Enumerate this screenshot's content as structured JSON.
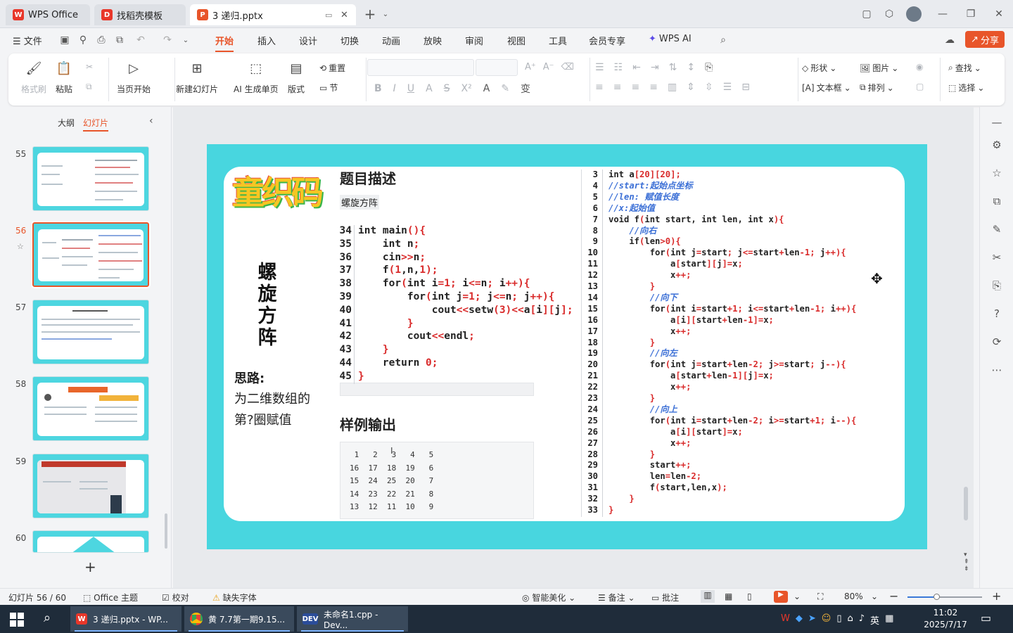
{
  "tabs": [
    {
      "label": "WPS Office"
    },
    {
      "label": "找稻壳模板"
    },
    {
      "label": "3  递归.pptx"
    }
  ],
  "menu": {
    "file": "文件",
    "items": [
      "开始",
      "插入",
      "设计",
      "切换",
      "动画",
      "放映",
      "审阅",
      "视图",
      "工具",
      "会员专享"
    ],
    "active": "开始",
    "wps_ai": "WPS AI",
    "share": "分享"
  },
  "ribbon": {
    "format_painter": "格式刷",
    "paste": "粘贴",
    "start_from_current": "当页开始",
    "new_slide": "新建幻灯片",
    "ai_page": "AI 生成单页",
    "layout": "版式",
    "reset": "重置",
    "section": "节",
    "shape": "形状",
    "picture": "图片",
    "find": "查找",
    "textbox": "文本框",
    "arrange": "排列",
    "select": "选择"
  },
  "left_pane": {
    "tab_outline": "大纲",
    "tab_slides": "幻灯片",
    "slides": [
      {
        "num": "55",
        "variant": "doc"
      },
      {
        "num": "56",
        "variant": "doc"
      },
      {
        "num": "57",
        "variant": "text"
      },
      {
        "num": "58",
        "variant": "orange"
      },
      {
        "num": "59",
        "variant": "video"
      },
      {
        "num": "60",
        "variant": "shape"
      }
    ],
    "selected": "56",
    "add": "+"
  },
  "slide": {
    "logo_text": "童织码",
    "title_vertical": [
      "螺",
      "旋",
      "方",
      "阵"
    ],
    "sec_desc": "题目描述",
    "sub_desc": "螺旋方阵",
    "sec_idea": "思路:",
    "idea_text": [
      "为二维数组的",
      "第?圈赋值"
    ],
    "sec_output": "样例输出",
    "sample_output": [
      " 1   2   3   4   5",
      "16  17  18  19   6",
      "15  24  25  20   7",
      "14  23  22  21   8",
      "13  12  11  10   9"
    ],
    "main_code": {
      "line_numbers": [
        "34",
        "35",
        "36",
        "37",
        "38",
        "39",
        "40",
        "41",
        "42",
        "43",
        "44",
        "45"
      ],
      "lines": [
        "int main(){",
        "    int n;",
        "    cin>>n;",
        "    f(1,n,1);",
        "    for(int i=1; i<=n; i++){",
        "        for(int j=1; j<=n; j++){",
        "            cout<<setw(3)<<a[i][j];",
        "        }",
        "        cout<<endl;",
        "    }",
        "    return 0;",
        "}"
      ]
    },
    "func_code": {
      "line_numbers": [
        "3",
        "4",
        "5",
        "6",
        "7",
        "8",
        "9",
        "10",
        "11",
        "12",
        "13",
        "14",
        "15",
        "16",
        "17",
        "18",
        "19",
        "20",
        "21",
        "22",
        "23",
        "24",
        "25",
        "26",
        "27",
        "28",
        "29",
        "30",
        "31",
        "32",
        "33"
      ],
      "lines": [
        "int a[20][20];",
        "//start:起始点坐标",
        "//len: 赋值长度",
        "//x:起始值",
        "void f(int start, int len, int x){",
        "    //向右",
        "    if(len>0){",
        "        for(int j=start; j<=start+len-1; j++){",
        "            a[start][j]=x;",
        "            x++;",
        "        }",
        "        //向下",
        "        for(int i=start+1; i<=start+len-1; i++){",
        "            a[i][start+len-1]=x;",
        "            x++;",
        "        }",
        "        //向左",
        "        for(int j=start+len-2; j>=start; j--){",
        "            a[start+len-1][j]=x;",
        "            x++;",
        "        }",
        "        //向上",
        "        for(int i=start+len-2; i>=start+1; i--){",
        "            a[i][start]=x;",
        "            x++;",
        "        }",
        "        start++;",
        "        len=len-2;",
        "        f(start,len,x);",
        "    }",
        "}"
      ]
    }
  },
  "status": {
    "slide_info": "幻灯片 56 / 60",
    "theme": "Office 主题",
    "proof": "校对",
    "missing_font": "缺失字体",
    "beautify": "智能美化",
    "notes": "备注",
    "comments": "批注",
    "zoom": "80%"
  },
  "taskbar": {
    "items": [
      {
        "label": "3  递归.pptx - WP..."
      },
      {
        "label": "黄 7.7第一期9.15..."
      },
      {
        "label": "未命名1.cpp - Dev..."
      }
    ],
    "ime": "英",
    "time": "11:02",
    "date": "2025/7/17"
  },
  "colors": {
    "accent": "#e8552a",
    "slide_bg": "#48d6df",
    "code_number": "#d92b2b",
    "code_comment": "#3b6fd6",
    "taskbar": "#1f2c3a"
  }
}
